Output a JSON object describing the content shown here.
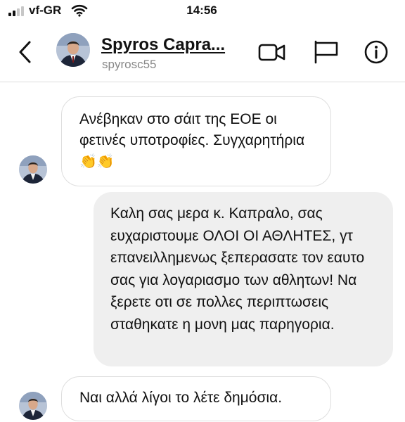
{
  "status_bar": {
    "carrier": "vf-GR",
    "time": "14:56"
  },
  "header": {
    "contact_name": "Spyros Capra...",
    "contact_handle": "spyrosc55",
    "icons": [
      "back-arrow-icon",
      "video-call-icon",
      "flag-icon",
      "info-icon"
    ]
  },
  "messages": [
    {
      "direction": "incoming",
      "text": "Ανέβηκαν στο σάιτ της ΕΟΕ οι φετινές υποτροφίες. Συγχαρητήρια",
      "emoji": "👏👏"
    },
    {
      "direction": "outgoing",
      "text": "Καλη σας μερα κ. Καπραλο, σας ευχαριστουμε ΟΛΟΙ ΟΙ ΑΘΛΗΤΕΣ, γτ επανειλλημενως ξεπερασατε τον εαυτο σας για λογαριασμο των αθλητων! Να ξερετε οτι σε πολλες περιπτωσεις σταθηκατε η μονη μας παρηγορια."
    },
    {
      "direction": "incoming",
      "text": "Ναι αλλά λίγοι το λέτε δημόσια."
    }
  ]
}
